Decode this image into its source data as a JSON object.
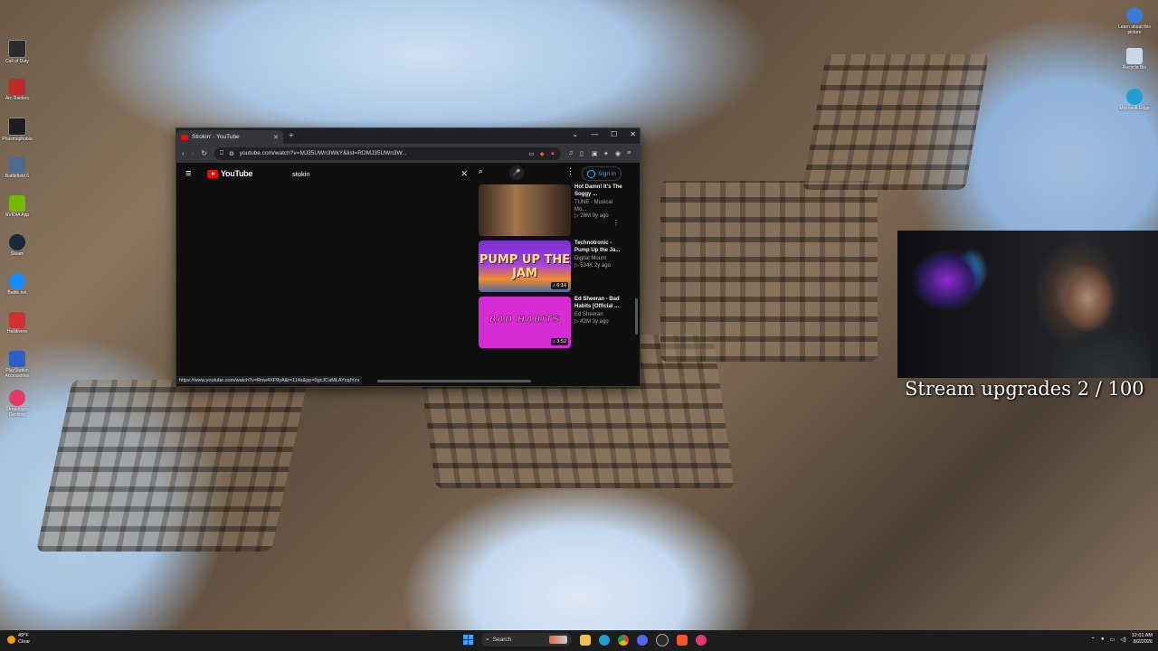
{
  "desktop": {
    "left_icons": [
      {
        "label": "Call of Duty",
        "icon": "cod-icon",
        "color": "#2b2b2b"
      },
      {
        "label": "Arc Raiders",
        "icon": "arc-raiders-icon",
        "color": "#c12a2a"
      },
      {
        "label": "Phasmophobia",
        "icon": "phasmophobia-icon",
        "color": "#1d1d1d"
      },
      {
        "label": "Battlefield 6",
        "icon": "battlefield-icon",
        "color": "#4b6c8c"
      },
      {
        "label": "NVIDIA App",
        "icon": "nvidia-icon",
        "color": "#76b900"
      },
      {
        "label": "Steam",
        "icon": "steam-icon",
        "color": "#1b2838"
      },
      {
        "label": "Battle.net",
        "icon": "battlenet-icon",
        "color": "#148eff"
      },
      {
        "label": "Helldivers",
        "icon": "game-icon",
        "color": "#d0302f"
      },
      {
        "label": "PlayStation Accessories",
        "icon": "playstation-icon",
        "color": "#2a5fc9"
      },
      {
        "label": "Streamlabs Desktop",
        "icon": "streamlabs-icon",
        "color": "#e23b6a"
      }
    ],
    "right_icons": [
      {
        "label": "Learn about this picture",
        "icon": "info-icon",
        "color": "#3a7bd5"
      },
      {
        "label": "Recycle Bin",
        "icon": "recycle-bin-icon",
        "color": "#c9d8e8"
      },
      {
        "label": "Microsoft Edge",
        "icon": "edge-icon",
        "color": "#1f9fd6"
      }
    ]
  },
  "browser": {
    "tab_title": "Strokin' - YouTube",
    "url": "youtube.com/watch?v=MJ35UWn3WkY&list=RDMJ35UWn3W...",
    "status_url": "https://www.youtube.com/watch?v=Rnw4XF9yA&t=114s&pp=0gcJCaMLAYcqIYzv"
  },
  "youtube": {
    "logo_text": "YouTube",
    "search_value": "stokin",
    "sign_in_label": "Sign in",
    "playlist": [
      {
        "title": "Hot Damn! It's The Soggy ...",
        "channel": "TUNE - Musical Mo...",
        "stats": "▷ 28M  9y ago",
        "duration": "",
        "thumb_text": ""
      },
      {
        "title": "Technotronic - Pump Up the Ja...",
        "channel": "Digital Mount",
        "stats": "▷ 534K  2y ago",
        "duration": "♪ 6:14",
        "thumb_text": "PUMP UP THE JAM"
      },
      {
        "title": "Ed Sheeran - Bad Habits [Official ...",
        "channel": "Ed Sheeran",
        "stats": "▷ 42M  3y ago",
        "duration": "♪ 3:52",
        "thumb_text": "BAD HABITS"
      }
    ]
  },
  "stream_overlay": {
    "caption": "Stream upgrades 2 / 100"
  },
  "taskbar": {
    "weather_temp": "49°F",
    "weather_desc": "Clear",
    "search_label": "Search",
    "time": "12:01 AM",
    "date": "8/2/2026"
  },
  "colors": {
    "youtube_red": "#ff0000",
    "link_blue": "#3ea6ff",
    "yt_bg": "#0f0f0f"
  }
}
